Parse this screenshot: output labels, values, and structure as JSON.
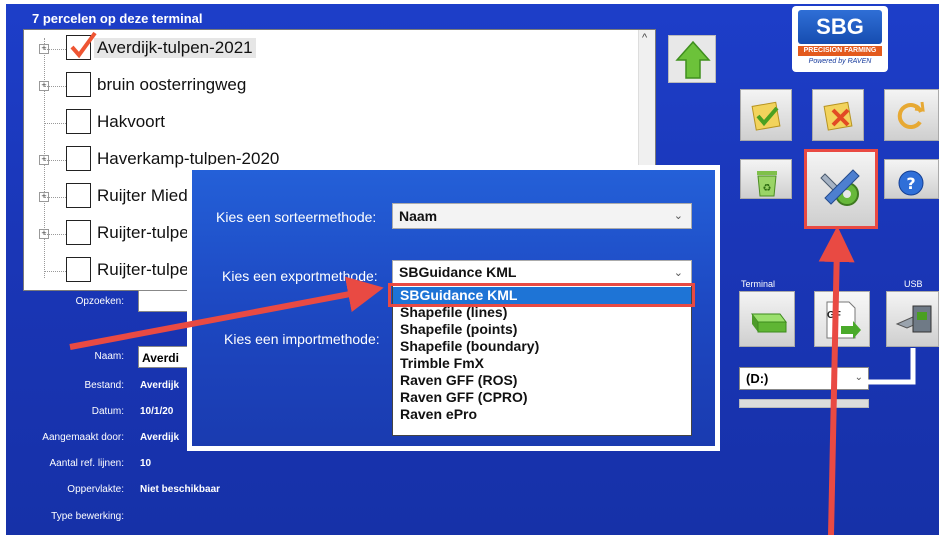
{
  "header": {
    "field_count_title": "7 percelen op deze terminal"
  },
  "fields": [
    {
      "name": "Averdijk-tulpen-2021",
      "checked": true,
      "expandable": true
    },
    {
      "name": "bruin oosterringweg",
      "checked": false,
      "expandable": true
    },
    {
      "name": "Hakvoort",
      "checked": false,
      "expandable": false
    },
    {
      "name": "Haverkamp-tulpen-2020",
      "checked": false,
      "expandable": true
    },
    {
      "name": "Ruijter Mied",
      "checked": false,
      "expandable": true
    },
    {
      "name": "Ruijter-tulpe",
      "checked": false,
      "expandable": true
    },
    {
      "name": "Ruijter-tulpe",
      "checked": false,
      "expandable": false
    }
  ],
  "logo": {
    "brand": "SBG",
    "tagline": "PRECISION FARMING",
    "powered_by": "Powered by RAVEN"
  },
  "dialog": {
    "sort_label": "Kies een sorteermethode:",
    "sort_value": "Naam",
    "export_label": "Kies een exportmethode:",
    "export_value": "SBGuidance KML",
    "import_label": "Kies een importmethode:",
    "export_options": [
      "SBGuidance KML",
      "Shapefile (lines)",
      "Shapefile (points)",
      "Shapefile (boundary)",
      "Trimble FmX",
      "Raven GFF (ROS)",
      "Raven GFF (CPRO)",
      "Raven ePro"
    ],
    "highlighted_option_index": 0
  },
  "info": {
    "lookup_label": "Opzoeken:",
    "naam_label": "Naam:",
    "naam_value": "Averdi",
    "bestand_label": "Bestand:",
    "bestand_value": "Averdijk",
    "datum_label": "Datum:",
    "datum_value": "10/1/20",
    "aangemaakt_label": "Aangemaakt door:",
    "aangemaakt_value": "Averdijk",
    "ref_lijnen_label": "Aantal ref. lijnen:",
    "ref_lijnen_value": "10",
    "oppervlakte_label": "Oppervlakte:",
    "oppervlakte_value": "Niet beschikbaar",
    "bewerking_label": "Type bewerking:"
  },
  "export_panel": {
    "terminal_label": "Terminal",
    "usb_label": "USB",
    "gff_label": "GF",
    "drive_value": "(D:)"
  },
  "colors": {
    "highlight_red": "#e94a43",
    "selection_blue": "#1e74d6",
    "app_blue": "#1a36b7"
  }
}
